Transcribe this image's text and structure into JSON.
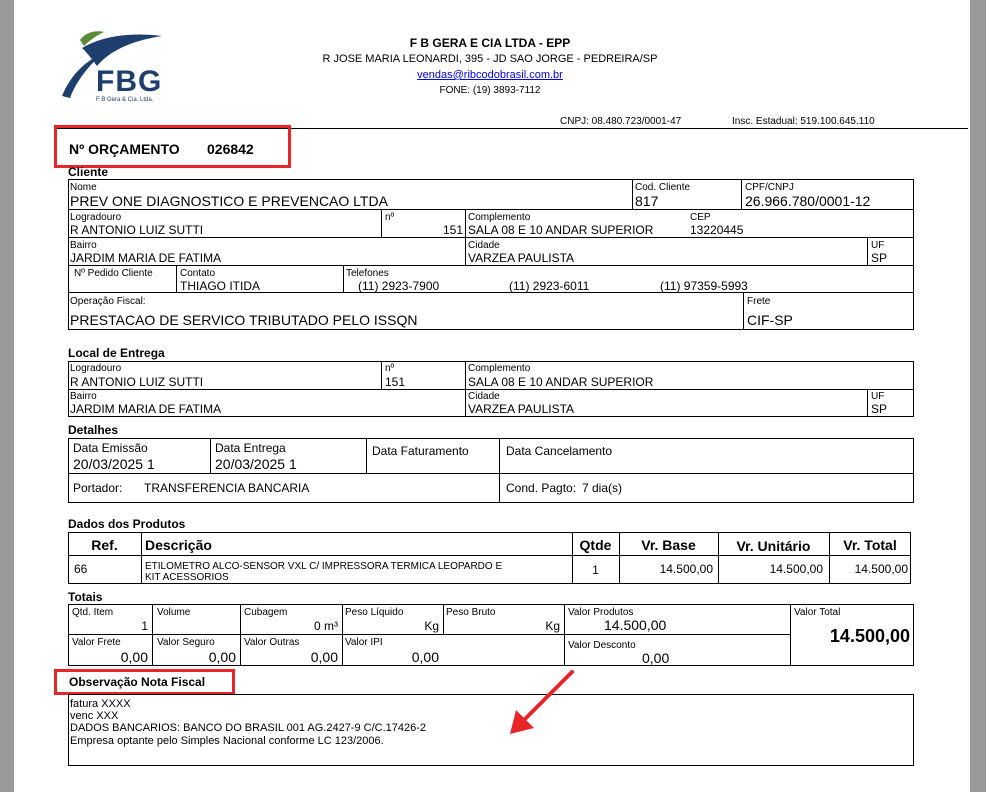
{
  "company": {
    "logo_text": "FBG",
    "logo_subtext": "F B Gera & Cia. Ltda.",
    "name": "F B GERA E CIA LTDA - EPP",
    "address": "R JOSE MARIA LEONARDI, 395 - JD SAO JORGE - PEDREIRA/SP",
    "email": "vendas@ribcodobrasil.com.br",
    "phone": "FONE: (19) 3893-7112",
    "cnpj": "CNPJ:  08.480.723/0001-47",
    "ie": "Insc. Estadual:  519.100.645.110"
  },
  "orcamento": {
    "label": "Nº ORÇAMENTO",
    "number": "026842"
  },
  "cliente": {
    "section": "Cliente",
    "nome_label": "Nome",
    "nome": "PREV ONE DIAGNOSTICO E PREVENCAO LTDA",
    "cod_label": "Cod. Cliente",
    "cod": "817",
    "cpf_label": "CPF/CNPJ",
    "cpf": "26.966.780/0001-12",
    "logradouro_label": "Logradouro",
    "logradouro": "R ANTONIO LUIZ SUTTI",
    "numero_label": "nº",
    "numero": "151",
    "complemento_label": "Complemento",
    "complemento": "SALA 08 E 10 ANDAR SUPERIOR",
    "cep_label": "CEP",
    "cep": "13220445",
    "bairro_label": "Bairro",
    "bairro": "JARDIM MARIA DE FATIMA",
    "cidade_label": "Cidade",
    "cidade": "VARZEA PAULISTA",
    "uf_label": "UF",
    "uf": "SP",
    "pedido_label": "Nº Pedido Cliente",
    "contato_label": "Contato",
    "contato": "THIAGO ITIDA",
    "telefones_label": "Telefones",
    "telefone1": "(11) 2923-7900",
    "telefone2": "(11) 2923-6011",
    "telefone3": "(11) 97359-5993",
    "operacao_label": "Operação Fiscal:",
    "operacao": "PRESTACAO DE SERVICO TRIBUTADO PELO ISSQN",
    "frete_label": "Frete",
    "frete": "CIF-SP"
  },
  "entrega": {
    "section": "Local de Entrega",
    "logradouro_label": "Logradouro",
    "logradouro": "R ANTONIO LUIZ SUTTI",
    "numero_label": "nº",
    "numero": "151",
    "complemento_label": "Complemento",
    "complemento": "SALA 08 E 10 ANDAR SUPERIOR",
    "bairro_label": "Bairro",
    "bairro": "JARDIM MARIA DE FATIMA",
    "cidade_label": "Cidade",
    "cidade": "VARZEA PAULISTA",
    "uf_label": "UF",
    "uf": "SP"
  },
  "detalhes": {
    "section": "Detalhes",
    "emissao_label": "Data Emissão",
    "emissao": "20/03/2025 1",
    "entrega_label": "Data Entrega",
    "entrega": "20/03/2025 1",
    "faturamento_label": "Data Faturamento",
    "cancelamento_label": "Data Cancelamento",
    "portador_label": "Portador:",
    "portador": "TRANSFERENCIA BANCARIA",
    "cond_label": "Cond. Pagto:",
    "cond": "7 dia(s)"
  },
  "produtos": {
    "section": "Dados dos Produtos",
    "headers": {
      "ref": "Ref.",
      "descricao": "Descrição",
      "qtde": "Qtde",
      "vr_base": "Vr. Base",
      "vr_unitario": "Vr. Unitário",
      "vr_total": "Vr. Total"
    },
    "rows": [
      {
        "ref": "66",
        "descricao_l1": "ETILOMETRO ALCO-SENSOR VXL C/ IMPRESSORA TERMICA LEOPARDO E",
        "descricao_l2": "KIT ACESSORIOS",
        "qtde": "1",
        "vr_base": "14.500,00",
        "vr_unitario": "14.500,00",
        "vr_total": "14.500,00"
      }
    ]
  },
  "totais": {
    "section": "Totais",
    "qtd_item_label": "Qtd. Item",
    "qtd_item": "1",
    "volume_label": "Volume",
    "cubagem_label": "Cubagem",
    "cubagem": "0 m³",
    "peso_liquido_label": "Peso Líquido",
    "peso_liquido": "Kg",
    "peso_bruto_label": "Peso Bruto",
    "peso_bruto": "Kg",
    "valor_produtos_label": "Valor Produtos",
    "valor_produtos": "14.500,00",
    "valor_total_label": "Valor Total",
    "valor_total": "14.500,00",
    "valor_frete_label": "Valor Frete",
    "valor_frete": "0,00",
    "valor_seguro_label": "Valor Seguro",
    "valor_seguro": "0,00",
    "valor_outras_label": "Valor Outras",
    "valor_outras": "0,00",
    "valor_ipi_label": "Valor IPI",
    "valor_ipi": "0,00",
    "valor_desconto_label": "Valor Desconto",
    "valor_desconto": "0,00"
  },
  "observacao": {
    "section": "Observação Nota Fiscal",
    "lines": [
      "fatura XXXX",
      "venc XXX",
      "DADOS BANCARIOS: BANCO DO BRASIL 001 AG.2427-9 C/C.17426-2",
      "Empresa optante pelo Simples Nacional conforme LC 123/2006."
    ]
  },
  "colors": {
    "highlight": "#e8262a",
    "logo_blue": "#1e3f6e",
    "logo_green": "#5b8a3a",
    "link": "#0000ee",
    "background": "#9a9a9a"
  }
}
